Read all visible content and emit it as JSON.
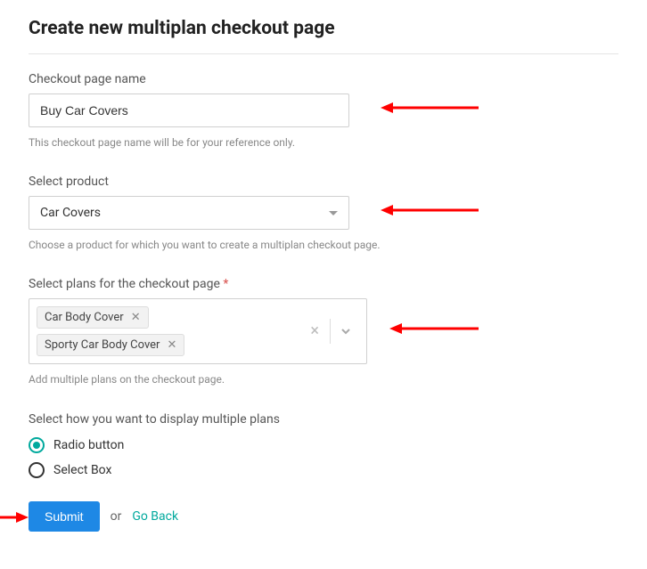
{
  "page_title": "Create new multiplan checkout page",
  "fields": {
    "name": {
      "label": "Checkout page name",
      "value": "Buy Car Covers",
      "help": "This checkout page name will be for your reference only."
    },
    "product": {
      "label": "Select product",
      "value": "Car Covers",
      "help": "Choose a product for which you want to create a multiplan checkout page."
    },
    "plans": {
      "label": "Select plans for the checkout page",
      "required_mark": "*",
      "tags": [
        "Car Body Cover",
        "Sporty Car Body Cover"
      ],
      "help": "Add multiple plans on the checkout page."
    },
    "display": {
      "label": "Select how you want to display multiple plans",
      "options": [
        "Radio button",
        "Select Box"
      ],
      "selected": "Radio button"
    }
  },
  "actions": {
    "submit": "Submit",
    "or": "or",
    "goback": "Go Back"
  }
}
